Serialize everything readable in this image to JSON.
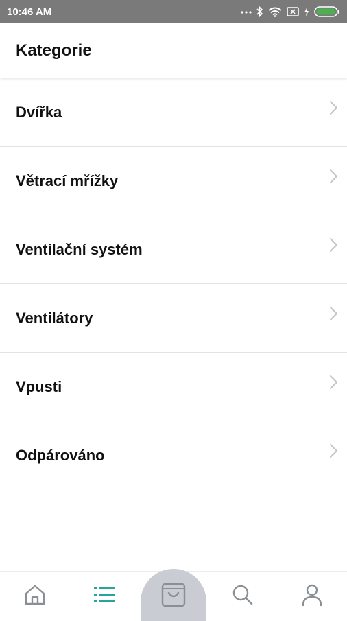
{
  "status_bar": {
    "time": "10:46 AM"
  },
  "header": {
    "title": "Kategorie"
  },
  "categories": [
    {
      "label": "Dvířka"
    },
    {
      "label": "Větrací mřížky"
    },
    {
      "label": "Ventilační systém"
    },
    {
      "label": "Ventilátory"
    },
    {
      "label": "Vpusti"
    },
    {
      "label": "Odpárováno"
    }
  ],
  "bottom_nav": {
    "items": [
      {
        "icon": "home-icon",
        "active": false
      },
      {
        "icon": "list-icon",
        "active": true
      },
      {
        "icon": "shopping-bag-icon",
        "active": false
      },
      {
        "icon": "search-icon",
        "active": false
      },
      {
        "icon": "user-icon",
        "active": false
      }
    ]
  },
  "colors": {
    "accent": "#26a69a",
    "icon_grey": "#8a8f96",
    "status_bar": "#7a7a7a",
    "cart_bubble": "#c9ccd2"
  }
}
